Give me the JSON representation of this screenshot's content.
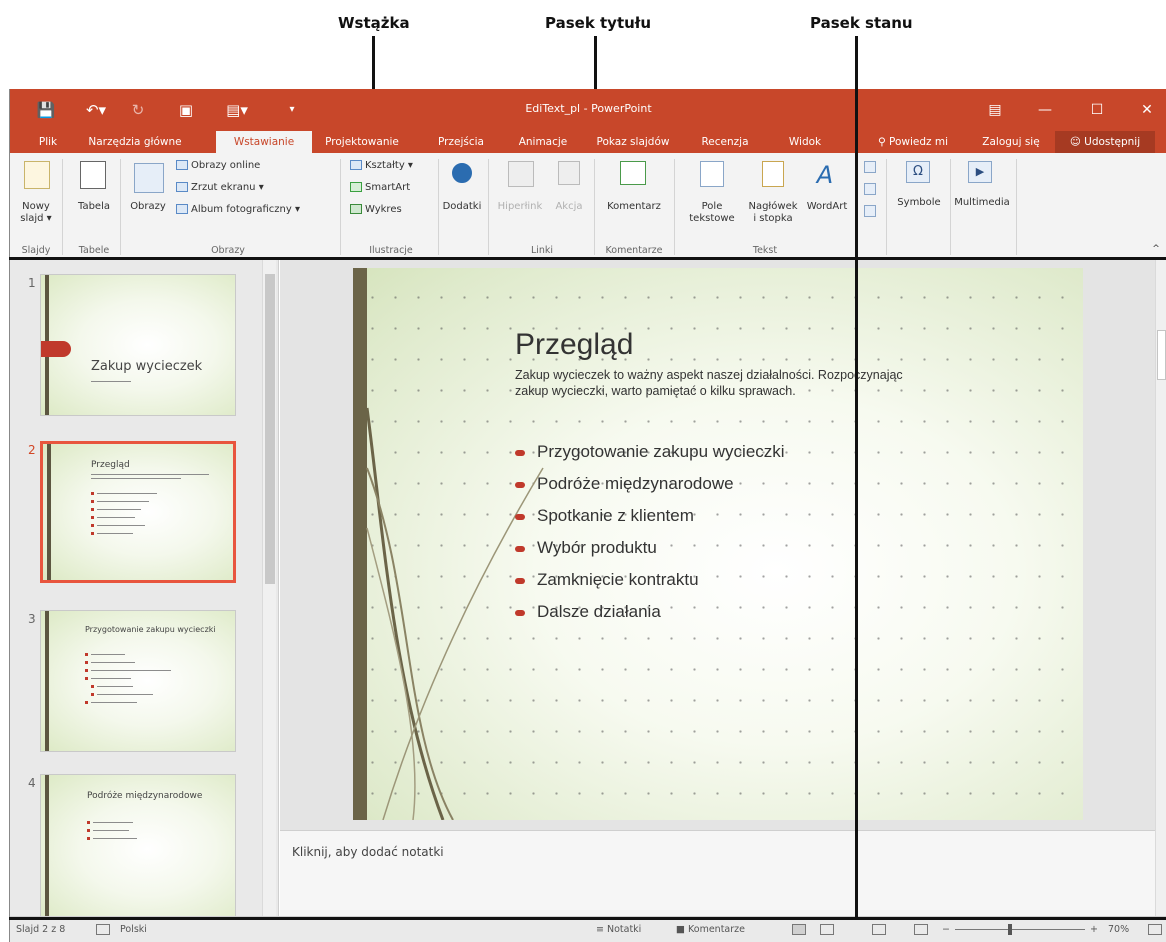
{
  "callouts": {
    "ribbon": "Wstążka",
    "title_bar": "Pasek tytułu",
    "status_bar": "Pasek stanu"
  },
  "titlebar": {
    "title": "EdiText_pl - PowerPoint",
    "icons": [
      "save-icon",
      "undo-icon",
      "redo-icon",
      "present-icon",
      "customize-icon"
    ]
  },
  "tabs": [
    {
      "label": "Plik"
    },
    {
      "label": "Narzędzia główne"
    },
    {
      "label": "Wstawianie",
      "active": true
    },
    {
      "label": "Projektowanie"
    },
    {
      "label": "Przejścia"
    },
    {
      "label": "Animacje"
    },
    {
      "label": "Pokaz slajdów"
    },
    {
      "label": "Recenzja"
    },
    {
      "label": "Widok"
    },
    {
      "label": "Powiedz mi"
    },
    {
      "label": "Zaloguj się"
    },
    {
      "label": "Udostępnij"
    }
  ],
  "ribbon": {
    "new_slide": "Nowy\nslajd",
    "new_slide_l1": "Nowy",
    "new_slide_l2": "slajd ▾",
    "table": "Tabela",
    "images": "Obrazy",
    "online_images": "Obrazy online",
    "screenshot": "Zrzut ekranu",
    "album": "Album fotograficzny",
    "shapes": "Kształty",
    "smartart": "SmartArt",
    "chart": "Wykres",
    "addins": "Dodatki",
    "hyperlink": "Hiperłink",
    "action": "Akcja",
    "comment": "Komentarz",
    "textbox_l1": "Pole",
    "textbox_l2": "tekstowe",
    "header_l1": "Nagłówek",
    "header_l2": "i stopka",
    "wordart": "WordArt",
    "symbols": "Symbole",
    "media": "Multimedia",
    "groups": {
      "slides": "Slajdy",
      "tables": "Tabele",
      "images": "Obrazy",
      "illustrations": "Ilustracje",
      "links": "Linki",
      "comments": "Komentarze",
      "text": "Tekst"
    }
  },
  "thumbnails": [
    {
      "num": "1",
      "title": "Zakup wycieczek"
    },
    {
      "num": "2",
      "title": "Przegląd"
    },
    {
      "num": "3",
      "title": "Przygotowanie zakupu wycieczki"
    },
    {
      "num": "4",
      "title": "Podróże międzynarodowe"
    }
  ],
  "slide": {
    "title": "Przegląd",
    "subtitle_l1": "Zakup wycieczek to ważny aspekt naszej działalności. Rozpoczynając",
    "subtitle_l2": "zakup wycieczki, warto pamiętać o kilku sprawach.",
    "bullets": [
      "Przygotowanie zakupu wycieczki",
      "Podróże międzynarodowe",
      "Spotkanie z klientem",
      "Wybór produktu",
      "Zamknięcie kontraktu",
      "Dalsze działania"
    ]
  },
  "notes": {
    "placeholder": "Kliknij, aby dodać notatki"
  },
  "status": {
    "slide_pos": "Slajd 2 z 8",
    "language": "Polski",
    "notes": "Notatki",
    "comments": "Komentarze",
    "zoom": "70%",
    "zoom_value": 0.42
  },
  "colors": {
    "accent": "#c8472a",
    "selection": "#e8553e",
    "bullet": "#c0392b"
  }
}
